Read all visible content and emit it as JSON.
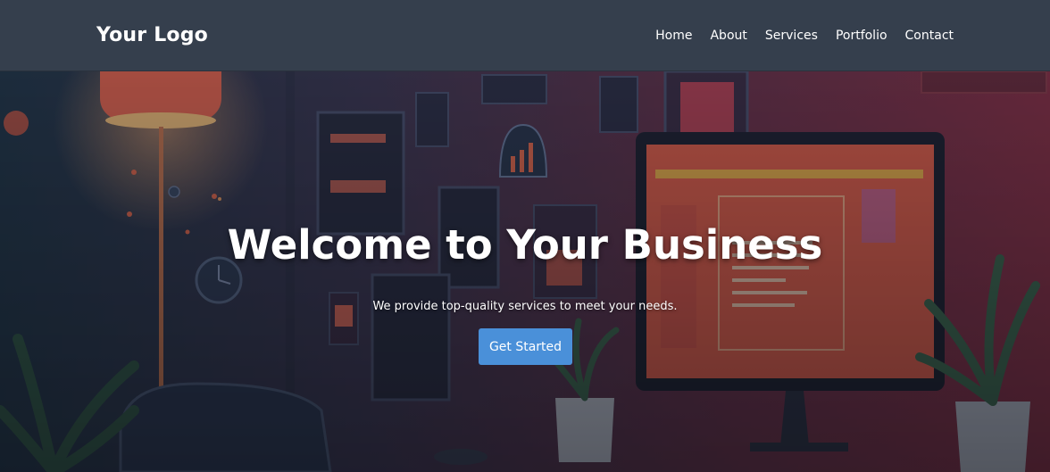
{
  "header": {
    "logo": "Your Logo",
    "nav": [
      "Home",
      "About",
      "Services",
      "Portfolio",
      "Contact"
    ]
  },
  "hero": {
    "title": "Welcome to Your Business",
    "subtitle": "We provide top-quality services to meet your needs.",
    "cta_label": "Get Started"
  },
  "colors": {
    "navbar": "#353f4d",
    "accent": "#4a90d9",
    "monitor_screen": "#e8604a"
  }
}
